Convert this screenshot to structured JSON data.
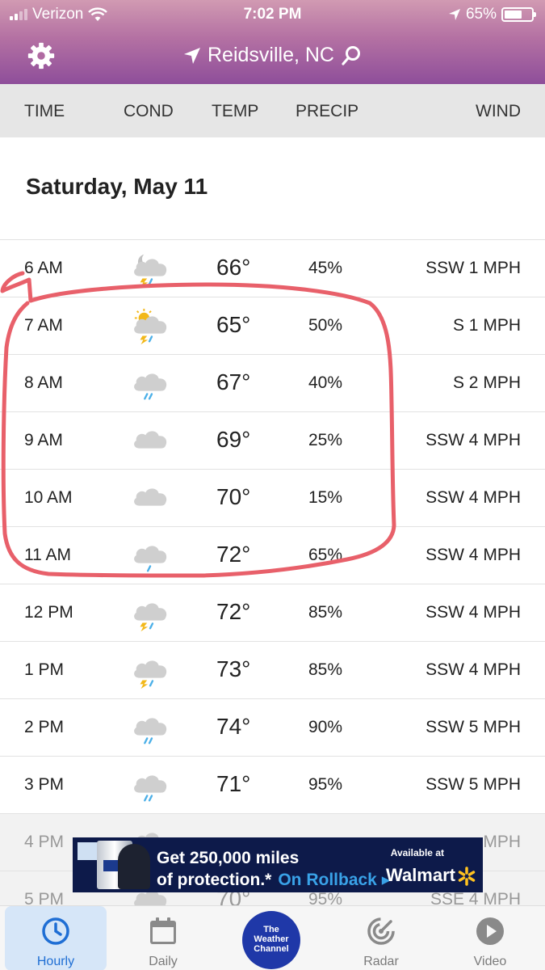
{
  "status_bar": {
    "carrier": "Verizon",
    "time": "7:02 PM",
    "battery": "65%",
    "battery_level": 0.65
  },
  "header": {
    "location": "Reidsville, NC",
    "settings_icon": "gear-icon",
    "location_icon": "location-arrow-icon",
    "search_icon": "search-icon"
  },
  "columns": {
    "time": "TIME",
    "cond": "COND",
    "temp": "TEMP",
    "precip": "PRECIP",
    "wind": "WIND"
  },
  "date": "Saturday, May 11",
  "hours": [
    {
      "time": "6 AM",
      "icon": "night-thunderstorm-icon",
      "temp": "66°",
      "precip": "45%",
      "wind": "SSW 1 MPH"
    },
    {
      "time": "7 AM",
      "icon": "sun-thunderstorm-icon",
      "temp": "65°",
      "precip": "50%",
      "wind": "S 1 MPH"
    },
    {
      "time": "8 AM",
      "icon": "rain-cloud-icon",
      "temp": "67°",
      "precip": "40%",
      "wind": "S 2 MPH"
    },
    {
      "time": "9 AM",
      "icon": "cloud-icon",
      "temp": "69°",
      "precip": "25%",
      "wind": "SSW 4 MPH"
    },
    {
      "time": "10 AM",
      "icon": "cloud-icon",
      "temp": "70°",
      "precip": "15%",
      "wind": "SSW 4 MPH"
    },
    {
      "time": "11 AM",
      "icon": "light-rain-cloud-icon",
      "temp": "72°",
      "precip": "65%",
      "wind": "SSW 4 MPH"
    },
    {
      "time": "12 PM",
      "icon": "thunderstorm-icon",
      "temp": "72°",
      "precip": "85%",
      "wind": "SSW 4 MPH"
    },
    {
      "time": "1 PM",
      "icon": "thunderstorm-icon",
      "temp": "73°",
      "precip": "85%",
      "wind": "SSW 4 MPH"
    },
    {
      "time": "2 PM",
      "icon": "rain-cloud-icon",
      "temp": "74°",
      "precip": "90%",
      "wind": "SSW 5 MPH"
    },
    {
      "time": "3 PM",
      "icon": "rain-cloud-icon",
      "temp": "71°",
      "precip": "95%",
      "wind": "SSW 5 MPH"
    },
    {
      "time": "4 PM",
      "icon": "rain-cloud-icon",
      "temp": "",
      "precip": "",
      "wind": "MPH"
    },
    {
      "time": "5 PM",
      "icon": "rain-cloud-icon",
      "temp": "70°",
      "precip": "95%",
      "wind": "SSE 4 MPH"
    }
  ],
  "ad": {
    "line1": "Get 250,000 miles",
    "line2": "of protection.*",
    "rollback": "On Rollback",
    "available": "Available at",
    "brand": "Walmart",
    "colors": {
      "background": "#0d1a4a",
      "accent": "#39a2e8",
      "spark": "#ffc220"
    }
  },
  "tabs": [
    {
      "label": "Hourly",
      "icon": "clock-icon",
      "active": true
    },
    {
      "label": "Daily",
      "icon": "calendar-icon",
      "active": false
    },
    {
      "label": "The Weather Channel",
      "icon": "twc-logo",
      "active": false
    },
    {
      "label": "Radar",
      "icon": "radar-icon",
      "active": false
    },
    {
      "label": "Video",
      "icon": "play-icon",
      "active": false
    }
  ],
  "colors": {
    "header_top": "#d19ab2",
    "header_bottom": "#8e4e9a",
    "active_tab": "#1f6ed4",
    "annotation": "#e8606a"
  }
}
